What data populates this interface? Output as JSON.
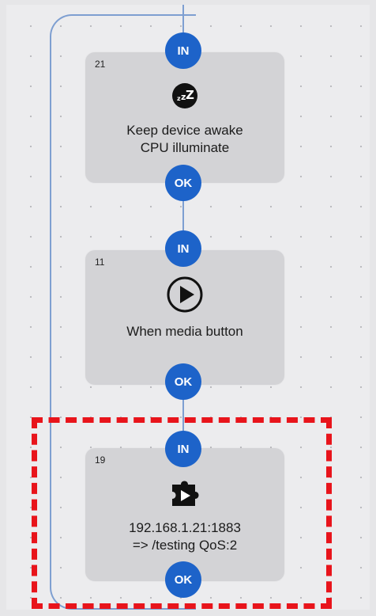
{
  "blocks": [
    {
      "number": "21",
      "icon": "sleep-zzz-icon",
      "line1": "Keep device awake",
      "line2": "CPU illuminate",
      "in_label": "IN",
      "ok_label": "OK"
    },
    {
      "number": "11",
      "icon": "play-icon",
      "line1": "When media button",
      "line2": "",
      "in_label": "IN",
      "ok_label": "OK"
    },
    {
      "number": "19",
      "icon": "plugin-play-icon",
      "line1": "192.168.1.21:1883",
      "line2": "=> /testing QoS:2",
      "in_label": "IN",
      "ok_label": "OK"
    }
  ],
  "colors": {
    "port": "#1d63c9",
    "connector": "#7e9fd1",
    "block_bg": "#d3d3d6",
    "highlight": "#e8141b"
  }
}
